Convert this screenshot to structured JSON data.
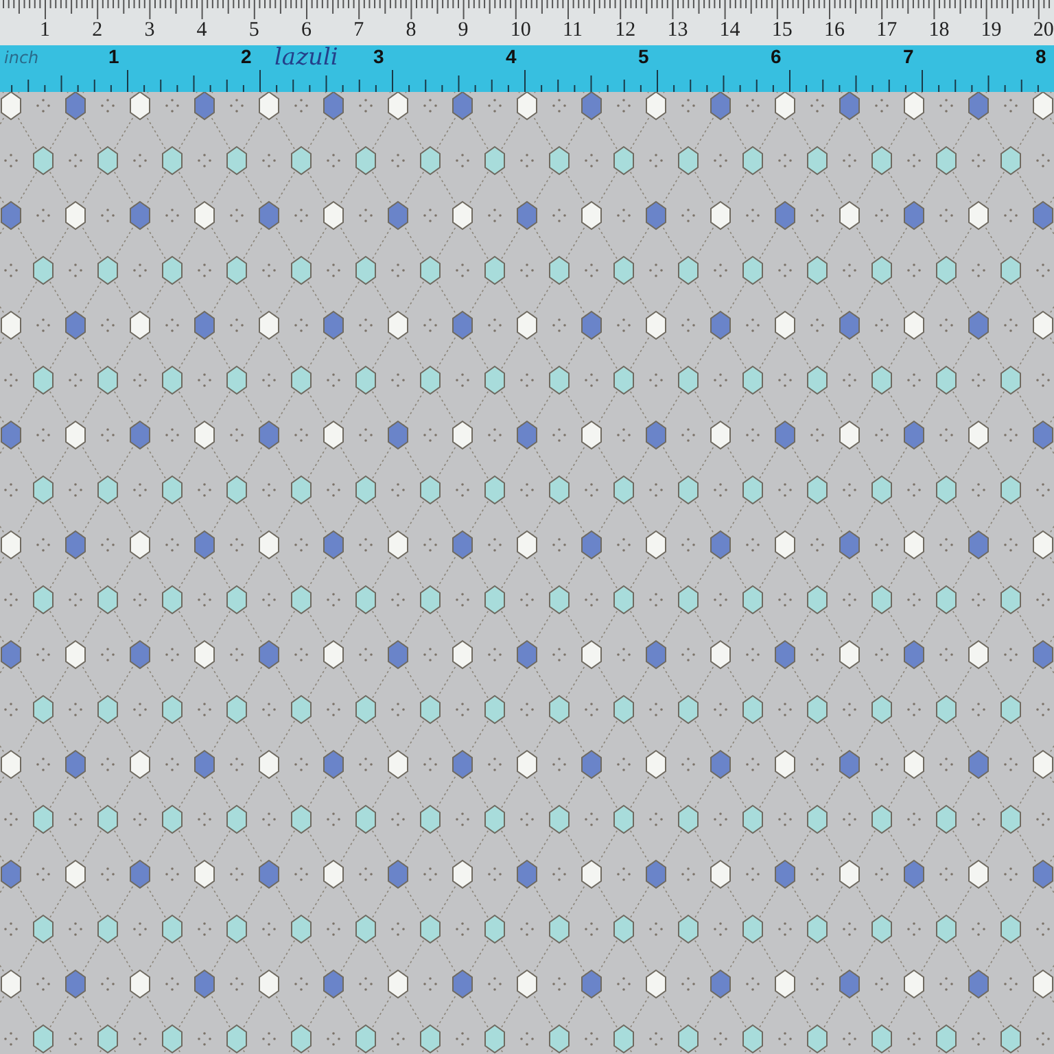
{
  "ruler": {
    "cm_numbers": [
      "1",
      "2",
      "3",
      "4",
      "5",
      "6",
      "7",
      "8",
      "9",
      "10",
      "11",
      "12",
      "13",
      "14",
      "15",
      "16",
      "17",
      "18",
      "19",
      "20"
    ],
    "inch_label": "inch",
    "inch_numbers": [
      "1",
      "2",
      "3",
      "4",
      "5",
      "6",
      "7",
      "8"
    ],
    "handwritten_note": "lazuli"
  }
}
